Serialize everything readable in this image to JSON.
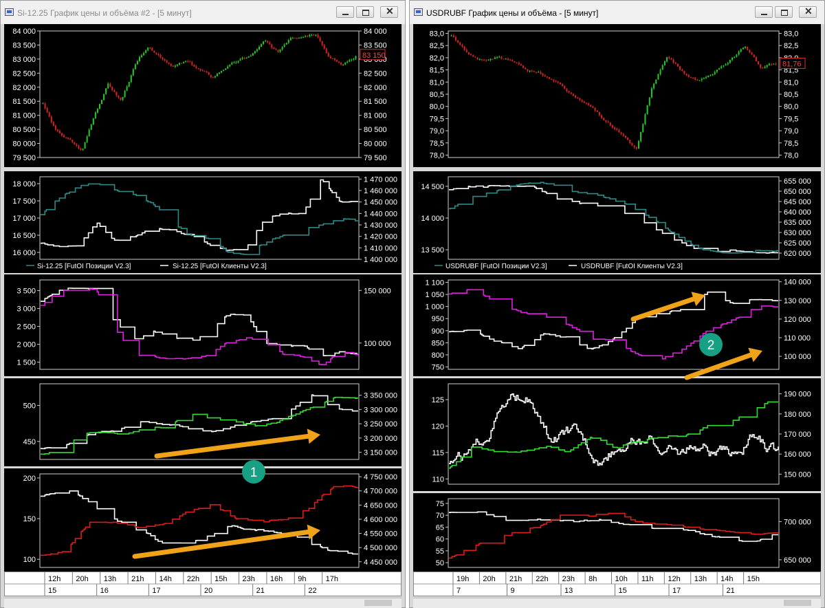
{
  "left_window": {
    "title": "Si-12.25 График цены и объёма #2 - [5 минут]",
    "price_last": "83 150",
    "time_axis": {
      "hours": [
        "12h",
        "20h",
        "13h",
        "21h",
        "14h",
        "22h",
        "15h",
        "23h",
        "16h",
        "9h",
        "17h"
      ],
      "days": [
        "15",
        "16",
        "17",
        "20",
        "21",
        "22"
      ]
    }
  },
  "right_window": {
    "title": "USDRUBF График цены и объёма - [5 минут]",
    "price_last": "81,76",
    "time_axis": {
      "hours": [
        "19h",
        "20h",
        "21h",
        "22h",
        "23h",
        "8h",
        "10h",
        "11h",
        "12h",
        "13h",
        "14h",
        "15h"
      ],
      "days": [
        "7",
        "9",
        "13",
        "15",
        "17",
        "21"
      ]
    }
  },
  "markers": [
    "1",
    "2"
  ],
  "colors": {
    "bull": "#22cc22",
    "bear": "#dd2222",
    "teal": "#2f8a88",
    "white": "#ffffff",
    "magenta": "#e020e0",
    "green": "#33dd33",
    "red": "#dd1c1c",
    "arrow": "#f0a318",
    "marker": "#17a084"
  },
  "chart_data": [
    {
      "type": "line",
      "window": "left",
      "panel": "price",
      "title": "Si-12.25 График цены и объёма #2 - [5 минут]",
      "y_ticks": [
        "84 000",
        "83 500",
        "83 000",
        "82 500",
        "82 000",
        "81 500",
        "81 000",
        "80 500",
        "80 000",
        "79 500"
      ],
      "ylim": [
        79500,
        84000
      ],
      "series": [
        {
          "values": [
            81400,
            80400,
            80100,
            79700,
            81100,
            82100,
            81500,
            82700,
            83400,
            83100,
            82800,
            82900,
            82600,
            82300,
            82700,
            82900,
            83100,
            83600,
            83200,
            83800,
            83900,
            84000,
            83100,
            82800,
            83150
          ]
        }
      ]
    },
    {
      "type": "line",
      "window": "left",
      "panel": "futoi-1",
      "y_ticks_left": [
        "18 000",
        "17 500",
        "17 000",
        "16 500",
        "16 000"
      ],
      "y_ticks_right": [
        "1 470 000",
        "1 460 000",
        "1 450 000",
        "1 440 000",
        "1 430 000",
        "1 420 000",
        "1 410 000",
        "1 400 000"
      ],
      "ylim_left": [
        15800,
        18200
      ],
      "ylim_right": [
        1400000,
        1472000
      ],
      "series": [
        {
          "name": "Si-12.25 [FutOI Позиции V2.3]",
          "axis": "left",
          "values": [
            17100,
            17600,
            17900,
            18000,
            17800,
            17700,
            17400,
            16900,
            16500,
            16400,
            16000,
            15950,
            16300,
            16500,
            16700,
            16800,
            17000,
            16900
          ]
        },
        {
          "name": "Si-12.25 [FutOI Клиенты V2.3]",
          "axis": "right",
          "values": [
            1414000,
            1410000,
            1412000,
            1432000,
            1416000,
            1420000,
            1428000,
            1426000,
            1422000,
            1412000,
            1408000,
            1410000,
            1436000,
            1440000,
            1440000,
            1470000,
            1452000,
            1450000
          ]
        }
      ]
    },
    {
      "type": "line",
      "window": "left",
      "panel": "futoi-2",
      "y_ticks_left": [
        "3 500",
        "3 000",
        "2 500",
        "2 000",
        "1 500"
      ],
      "y_ticks_right": [
        "150 000",
        "100 000"
      ],
      "ylim_left": [
        1300,
        3800
      ],
      "ylim_right": [
        75000,
        160000
      ],
      "series": [
        {
          "axis": "left",
          "values": [
            3100,
            3500,
            3600,
            3500,
            2400,
            1700,
            1650,
            1600,
            1600,
            1700,
            2100,
            2200,
            2050,
            1700,
            1650,
            1400,
            1800,
            1700
          ]
        },
        {
          "axis": "right",
          "values": [
            140000,
            150000,
            152000,
            151000,
            118000,
            104000,
            112000,
            105000,
            103000,
            108000,
            128000,
            127000,
            100000,
            98000,
            97000,
            87000,
            92000,
            89000
          ]
        }
      ]
    },
    {
      "type": "line",
      "window": "left",
      "panel": "futoi-3",
      "y_ticks_left": [
        "500",
        "450"
      ],
      "y_ticks_right": [
        "3 350 000",
        "3 300 000",
        "3 250 000",
        "3 200 000",
        "3 150 000"
      ],
      "ylim_left": [
        425,
        530
      ],
      "ylim_right": [
        3125000,
        3390000
      ],
      "series": [
        {
          "axis": "left",
          "values": [
            432,
            438,
            462,
            463,
            460,
            470,
            470,
            490,
            482,
            478,
            472,
            476,
            487,
            500,
            512,
            510
          ]
        },
        {
          "axis": "right",
          "values": [
            3165000,
            3175000,
            3215000,
            3225000,
            3255000,
            3250000,
            3235000,
            3228000,
            3248000,
            3260000,
            3278000,
            3355000,
            3305000,
            3290000
          ]
        }
      ]
    },
    {
      "type": "line",
      "window": "left",
      "panel": "futoi-4",
      "y_ticks_left": [
        "200",
        "150",
        "100"
      ],
      "y_ticks_right": [
        "4 750 000",
        "4 700 000",
        "4 650 000",
        "4 600 000",
        "4 550 000",
        "4 500 000",
        "4 450 000"
      ],
      "ylim_left": [
        90,
        205
      ],
      "ylim_right": [
        4430000,
        4760000
      ],
      "series": [
        {
          "axis": "left",
          "values": [
            105,
            110,
            145,
            145,
            140,
            142,
            158,
            168,
            150,
            148,
            150,
            165,
            190,
            188
          ]
        },
        {
          "axis": "right",
          "values": [
            4680000,
            4700000,
            4620000,
            4560000,
            4510000,
            4530000,
            4580000,
            4560000,
            4540000,
            4490000,
            4480000
          ]
        }
      ]
    },
    {
      "type": "line",
      "window": "right",
      "panel": "price",
      "title": "USDRUBF График цены и объёма - [5 минут]",
      "y_ticks": [
        "83,0",
        "82,5",
        "82,0",
        "81,5",
        "81,0",
        "80,5",
        "80,0",
        "79,5",
        "79,0",
        "78,5",
        "78,0"
      ],
      "ylim": [
        77.9,
        83.1
      ],
      "series": [
        {
          "values": [
            82.9,
            82.2,
            81.9,
            82.0,
            81.8,
            81.5,
            81.3,
            81.0,
            80.3,
            80.0,
            79.4,
            78.9,
            78.2,
            80.8,
            82.0,
            81.4,
            81.0,
            81.3,
            81.9,
            82.5,
            81.6,
            81.76
          ]
        }
      ]
    },
    {
      "type": "line",
      "window": "right",
      "panel": "futoi-1",
      "y_ticks_left": [
        "14 500",
        "14 000",
        "13 500"
      ],
      "y_ticks_right": [
        "655 000",
        "650 000",
        "645 000",
        "640 000",
        "635 000",
        "630 000",
        "625 000",
        "620 000"
      ],
      "ylim_left": [
        13350,
        14650
      ],
      "ylim_right": [
        617000,
        657000
      ],
      "series": [
        {
          "name": "USDRUBF [FutOI Позиции V2.3]",
          "axis": "left",
          "values": [
            14150,
            14350,
            14450,
            14550,
            14550,
            14400,
            14350,
            14200,
            14000,
            13700,
            13500,
            13450,
            13480,
            13500
          ]
        },
        {
          "name": "USDRUBF [FutOI Клиенты V2.3]",
          "axis": "right",
          "values": [
            651000,
            652000,
            653000,
            653000,
            646000,
            644000,
            642000,
            636000,
            628000,
            622000,
            621000,
            620000,
            620000
          ]
        }
      ]
    },
    {
      "type": "line",
      "window": "right",
      "panel": "futoi-2",
      "y_ticks_left": [
        "1 100",
        "1 050",
        "1 000",
        "950",
        "900",
        "850",
        "800",
        "750"
      ],
      "y_ticks_right": [
        "140 000",
        "130 000",
        "120 000",
        "110 000",
        "100 000"
      ],
      "ylim_left": [
        740,
        1110
      ],
      "ylim_right": [
        93000,
        141000
      ],
      "series": [
        {
          "axis": "left",
          "values": [
            1050,
            1070,
            1010,
            980,
            960,
            930,
            870,
            860,
            800,
            780,
            830,
            900,
            940,
            1000,
            1000
          ]
        },
        {
          "axis": "right",
          "values": [
            113000,
            114000,
            108000,
            104000,
            112000,
            110000,
            103000,
            109000,
            121000,
            123000,
            126000,
            134000,
            129000,
            131000,
            129000
          ]
        }
      ]
    },
    {
      "type": "line",
      "window": "right",
      "panel": "futoi-3",
      "y_ticks_left": [
        "125",
        "120",
        "115",
        "110"
      ],
      "y_ticks_right": [
        "190 000",
        "180 000",
        "170 000",
        "160 000",
        "150 000"
      ],
      "ylim_left": [
        109,
        128
      ],
      "ylim_right": [
        145000,
        195000
      ],
      "series": [
        {
          "axis": "left",
          "values": [
            112,
            116,
            115,
            115,
            116,
            115,
            118,
            116,
            117,
            118,
            118,
            120,
            121,
            123,
            126
          ]
        },
        {
          "axis": "right",
          "values": [
            155000,
            160000,
            180000,
            190000,
            165000,
            170000,
            158000,
            168000,
            165000,
            160000,
            165000,
            158000,
            168000,
            160000
          ]
        }
      ]
    },
    {
      "type": "line",
      "window": "right",
      "panel": "futoi-4",
      "y_ticks_left": [
        "75",
        "70",
        "65",
        "60",
        "55",
        "50"
      ],
      "y_ticks_right": [
        "700 000",
        "650 000"
      ],
      "ylim_left": [
        48,
        77
      ],
      "ylim_right": [
        640000,
        730000
      ],
      "series": [
        {
          "axis": "left",
          "values": [
            52,
            57,
            60,
            64,
            66,
            72,
            70,
            71,
            67,
            66,
            65,
            64,
            63,
            62,
            63
          ]
        },
        {
          "axis": "right",
          "values": [
            712000,
            712000,
            700000,
            703000,
            700000,
            702000,
            695000,
            690000,
            688000,
            680000,
            672000,
            685000
          ]
        }
      ]
    }
  ]
}
